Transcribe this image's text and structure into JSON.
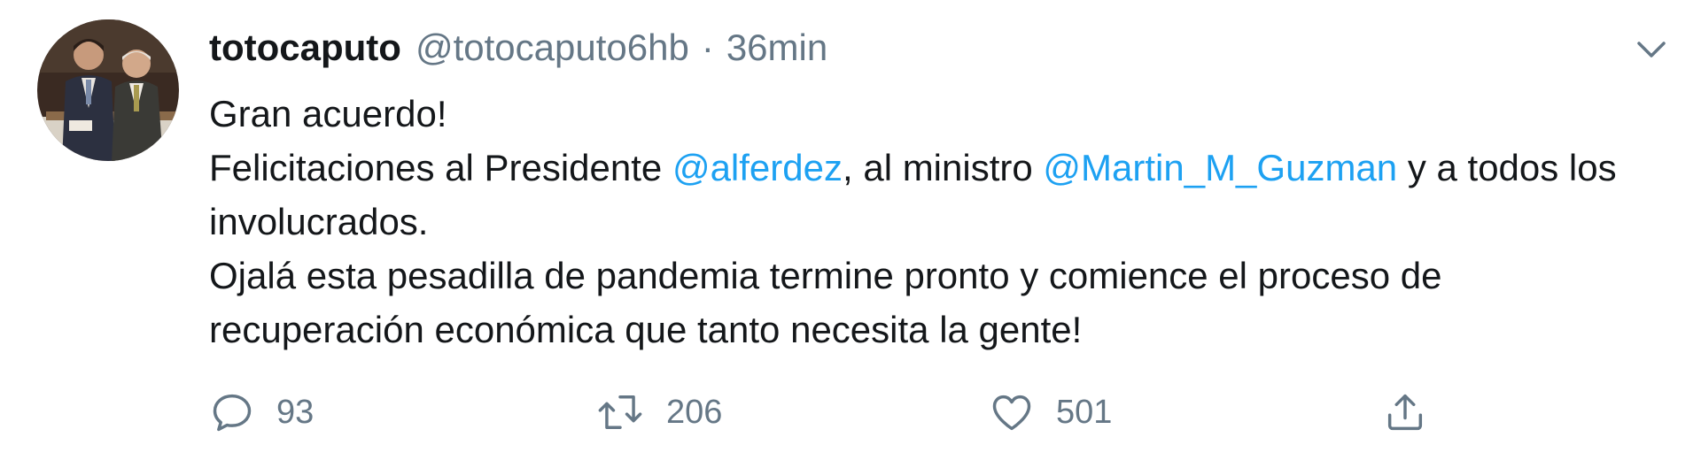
{
  "tweet": {
    "display_name": "totocaputo",
    "handle": "@totocaputo6hb",
    "separator": "·",
    "time": "36min",
    "body": {
      "line1": "Gran acuerdo!",
      "line2_pre": "Felicitaciones al Presidente ",
      "mention1": "@alferdez",
      "line2_mid": ", al ministro ",
      "mention2": "@Martin_M_Guzman",
      "line2_post": " y a todos los involucrados.",
      "line3": "Ojalá esta pesadilla de pandemia termine pronto y comience el proceso de recuperación económica que tanto necesita la gente!"
    },
    "stats": {
      "replies": "93",
      "retweets": "206",
      "likes": "501"
    }
  },
  "icons": {
    "reply": "reply-icon",
    "retweet": "retweet-icon",
    "like": "heart-icon",
    "share": "share-icon",
    "more": "chevron-down-icon"
  },
  "colors": {
    "text": "#14171a",
    "secondary": "#657786",
    "link": "#1da1f2"
  }
}
